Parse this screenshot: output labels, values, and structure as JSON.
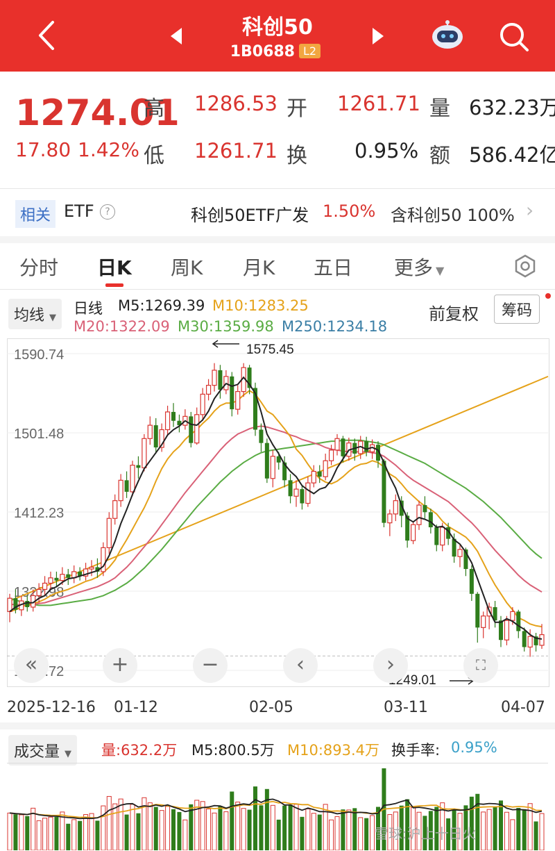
{
  "header": {
    "title": "科创50",
    "code": "1B0688",
    "level_badge": "L2",
    "background_color": "#e8302b"
  },
  "quote": {
    "price": "1274.01",
    "change": "17.80",
    "change_pct": "1.42%",
    "labels": {
      "high": "高",
      "open": "开",
      "volume": "量",
      "low": "低",
      "turnover": "换",
      "amount": "额"
    },
    "high": "1286.53",
    "open": "1261.71",
    "volume": "632.23万",
    "low": "1261.71",
    "turnover_rate": "0.95%",
    "amount": "586.42亿"
  },
  "etf_bar": {
    "related_label": "相关",
    "etf_label": "ETF",
    "help_glyph": "?",
    "fund_name": "科创50ETF广发",
    "fund_change": "1.50%",
    "contains_label": "含科创50",
    "contains_pct": "100%"
  },
  "tabs": [
    {
      "label": "分时",
      "active": false
    },
    {
      "label": "日K",
      "active": true
    },
    {
      "label": "周K",
      "active": false
    },
    {
      "label": "月K",
      "active": false
    },
    {
      "label": "五日",
      "active": false
    },
    {
      "label": "更多",
      "active": false
    }
  ],
  "ma_bar": {
    "selector": "均线",
    "period": "日线",
    "m5": "M5:1269.39",
    "m10": "M10:1283.25",
    "m20": "M20:1322.09",
    "m30": "M30:1359.98",
    "m250": "M250:1234.18",
    "adjust": "前复权",
    "chips_button": "筹码",
    "colors": {
      "m5": "#222222",
      "m10": "#e5a21a",
      "m20": "#d96177",
      "m30": "#5aac44",
      "m250": "#3a7ea5",
      "rise": "#d9342f",
      "fall": "#2f7d1c"
    }
  },
  "controls": [
    "«",
    "+",
    "−",
    "‹",
    "›"
  ],
  "chart_data": {
    "type": "candlestick",
    "y_ticks": [
      "1590.74",
      "1501.48",
      "1412.23",
      "1322.98",
      "1233.72"
    ],
    "x_ticks": [
      "2025-12-16",
      "01-12",
      "02-05",
      "03-11",
      "04-07"
    ],
    "annotations": [
      "1575.45",
      "1249.01"
    ],
    "ylim": [
      1233.72,
      1590.74
    ],
    "candles": [
      [
        1300,
        1315,
        1288,
        1320
      ],
      [
        1315,
        1302,
        1298,
        1325
      ],
      [
        1302,
        1312,
        1295,
        1318
      ],
      [
        1312,
        1305,
        1300,
        1318
      ],
      [
        1305,
        1318,
        1300,
        1325
      ],
      [
        1318,
        1325,
        1310,
        1332
      ],
      [
        1325,
        1332,
        1318,
        1340
      ],
      [
        1332,
        1338,
        1325,
        1345
      ],
      [
        1338,
        1335,
        1328,
        1345
      ],
      [
        1335,
        1342,
        1330,
        1350
      ],
      [
        1342,
        1338,
        1330,
        1348
      ],
      [
        1338,
        1345,
        1332,
        1352
      ],
      [
        1345,
        1340,
        1335,
        1350
      ],
      [
        1340,
        1348,
        1335,
        1355
      ],
      [
        1348,
        1350,
        1340,
        1358
      ],
      [
        1350,
        1345,
        1338,
        1360
      ],
      [
        1345,
        1372,
        1340,
        1378
      ],
      [
        1372,
        1405,
        1365,
        1412
      ],
      [
        1405,
        1425,
        1398,
        1432
      ],
      [
        1425,
        1448,
        1418,
        1455
      ],
      [
        1448,
        1435,
        1428,
        1458
      ],
      [
        1435,
        1465,
        1430,
        1470
      ],
      [
        1465,
        1462,
        1450,
        1475
      ],
      [
        1462,
        1495,
        1458,
        1500
      ],
      [
        1495,
        1510,
        1488,
        1520
      ],
      [
        1510,
        1485,
        1478,
        1518
      ],
      [
        1485,
        1505,
        1480,
        1512
      ],
      [
        1505,
        1525,
        1498,
        1532
      ],
      [
        1525,
        1515,
        1508,
        1535
      ],
      [
        1515,
        1510,
        1502,
        1522
      ],
      [
        1510,
        1520,
        1505,
        1528
      ],
      [
        1520,
        1490,
        1485,
        1525
      ],
      [
        1490,
        1522,
        1488,
        1530
      ],
      [
        1522,
        1545,
        1515,
        1552
      ],
      [
        1545,
        1555,
        1538,
        1562
      ],
      [
        1555,
        1572,
        1548,
        1580
      ],
      [
        1572,
        1550,
        1540,
        1578
      ],
      [
        1550,
        1565,
        1545,
        1572
      ],
      [
        1565,
        1528,
        1520,
        1570
      ],
      [
        1528,
        1548,
        1522,
        1555
      ],
      [
        1548,
        1575,
        1542,
        1580
      ],
      [
        1575,
        1552,
        1545,
        1578
      ],
      [
        1552,
        1505,
        1498,
        1558
      ],
      [
        1505,
        1490,
        1480,
        1512
      ],
      [
        1490,
        1450,
        1445,
        1495
      ],
      [
        1450,
        1475,
        1440,
        1482
      ],
      [
        1475,
        1468,
        1460,
        1480
      ],
      [
        1468,
        1448,
        1440,
        1475
      ],
      [
        1448,
        1430,
        1422,
        1455
      ],
      [
        1430,
        1438,
        1418,
        1448
      ],
      [
        1438,
        1422,
        1415,
        1442
      ],
      [
        1422,
        1445,
        1418,
        1452
      ],
      [
        1445,
        1458,
        1440,
        1465
      ],
      [
        1458,
        1452,
        1445,
        1465
      ],
      [
        1452,
        1470,
        1448,
        1478
      ],
      [
        1470,
        1482,
        1465,
        1488
      ],
      [
        1482,
        1495,
        1476,
        1500
      ],
      [
        1495,
        1475,
        1468,
        1498
      ],
      [
        1475,
        1490,
        1470,
        1496
      ],
      [
        1490,
        1478,
        1470,
        1495
      ],
      [
        1478,
        1492,
        1472,
        1498
      ],
      [
        1492,
        1480,
        1475,
        1497
      ],
      [
        1480,
        1488,
        1472,
        1494
      ],
      [
        1488,
        1470,
        1462,
        1492
      ],
      [
        1470,
        1400,
        1395,
        1472
      ],
      [
        1400,
        1410,
        1385,
        1415
      ],
      [
        1410,
        1425,
        1402,
        1432
      ],
      [
        1425,
        1408,
        1395,
        1430
      ],
      [
        1408,
        1380,
        1372,
        1412
      ],
      [
        1380,
        1398,
        1376,
        1402
      ],
      [
        1398,
        1420,
        1392,
        1425
      ],
      [
        1420,
        1412,
        1405,
        1430
      ],
      [
        1412,
        1395,
        1388,
        1416
      ],
      [
        1395,
        1375,
        1368,
        1398
      ],
      [
        1375,
        1395,
        1368,
        1400
      ],
      [
        1395,
        1382,
        1375,
        1400
      ],
      [
        1382,
        1362,
        1355,
        1388
      ],
      [
        1362,
        1370,
        1350,
        1375
      ],
      [
        1370,
        1348,
        1340,
        1372
      ],
      [
        1348,
        1320,
        1312,
        1352
      ],
      [
        1320,
        1282,
        1265,
        1322
      ],
      [
        1282,
        1295,
        1270,
        1300
      ],
      [
        1295,
        1305,
        1280,
        1310
      ],
      [
        1305,
        1290,
        1282,
        1312
      ],
      [
        1290,
        1268,
        1260,
        1295
      ],
      [
        1268,
        1290,
        1262,
        1295
      ],
      [
        1290,
        1300,
        1285,
        1305
      ],
      [
        1300,
        1278,
        1270,
        1302
      ],
      [
        1278,
        1260,
        1255,
        1282
      ],
      [
        1260,
        1272,
        1249,
        1280
      ],
      [
        1272,
        1262,
        1255,
        1276
      ],
      [
        1262,
        1274,
        1258,
        1286
      ]
    ],
    "ma5": [
      1300,
      1305,
      1308,
      1310,
      1310,
      1315,
      1318,
      1325,
      1328,
      1333,
      1337,
      1338,
      1340,
      1342,
      1344,
      1346,
      1351,
      1363,
      1379,
      1399,
      1415,
      1432,
      1447,
      1461,
      1470,
      1479,
      1488,
      1499,
      1505,
      1509,
      1515,
      1511,
      1510,
      1516,
      1526,
      1540,
      1549,
      1557,
      1554,
      1556,
      1564,
      1556,
      1546,
      1525,
      1500,
      1488,
      1478,
      1466,
      1458,
      1452,
      1442,
      1437,
      1433,
      1438,
      1440,
      1448,
      1462,
      1472,
      1482,
      1484,
      1486,
      1483,
      1485,
      1482,
      1468,
      1452,
      1439,
      1420,
      1405,
      1401,
      1406,
      1404,
      1401,
      1395,
      1396,
      1391,
      1381,
      1376,
      1367,
      1355,
      1337,
      1319,
      1301,
      1288,
      1288,
      1292,
      1289,
      1284,
      1280,
      1274,
      1270,
      1269
    ],
    "ma10": [
      1300,
      1302,
      1305,
      1308,
      1309,
      1311,
      1314,
      1318,
      1321,
      1323,
      1325,
      1328,
      1331,
      1334,
      1336,
      1339,
      1344,
      1350,
      1358,
      1370,
      1381,
      1393,
      1405,
      1417,
      1431,
      1447,
      1461,
      1472,
      1480,
      1486,
      1494,
      1500,
      1505,
      1512,
      1518,
      1526,
      1532,
      1535,
      1535,
      1538,
      1544,
      1549,
      1545,
      1536,
      1526,
      1522,
      1514,
      1506,
      1497,
      1483,
      1476,
      1466,
      1457,
      1450,
      1446,
      1444,
      1447,
      1452,
      1458,
      1463,
      1466,
      1467,
      1470,
      1468,
      1463,
      1455,
      1451,
      1444,
      1436,
      1430,
      1424,
      1419,
      1415,
      1410,
      1402,
      1396,
      1392,
      1388,
      1384,
      1377,
      1368,
      1355,
      1342,
      1330,
      1320,
      1310,
      1302,
      1293,
      1290,
      1286,
      1284,
      1283
    ],
    "ma20": [
      1308,
      1308,
      1307,
      1307,
      1308,
      1309,
      1310,
      1312,
      1314,
      1316,
      1318,
      1320,
      1322,
      1324,
      1326,
      1328,
      1331,
      1334,
      1338,
      1344,
      1350,
      1357,
      1365,
      1373,
      1381,
      1389,
      1398,
      1407,
      1416,
      1425,
      1434,
      1442,
      1450,
      1458,
      1466,
      1474,
      1482,
      1489,
      1495,
      1500,
      1503,
      1506,
      1508,
      1509,
      1508,
      1506,
      1504,
      1502,
      1499,
      1497,
      1494,
      1492,
      1490,
      1488,
      1485,
      1483,
      1482,
      1481,
      1480,
      1480,
      1480,
      1480,
      1479,
      1478,
      1475,
      1470,
      1465,
      1459,
      1453,
      1448,
      1444,
      1440,
      1436,
      1432,
      1428,
      1424,
      1418,
      1412,
      1406,
      1400,
      1393,
      1385,
      1377,
      1369,
      1362,
      1355,
      1348,
      1341,
      1335,
      1330,
      1326,
      1322
    ],
    "ma30": [
      1315,
      1313,
      1311,
      1309,
      1308,
      1307,
      1307,
      1307,
      1308,
      1309,
      1310,
      1311,
      1312,
      1313,
      1314,
      1316,
      1318,
      1321,
      1324,
      1328,
      1332,
      1337,
      1343,
      1349,
      1356,
      1363,
      1370,
      1378,
      1386,
      1394,
      1402,
      1410,
      1418,
      1425,
      1432,
      1439,
      1446,
      1452,
      1458,
      1463,
      1468,
      1472,
      1476,
      1479,
      1481,
      1482,
      1483,
      1484,
      1485,
      1486,
      1487,
      1488,
      1489,
      1490,
      1491,
      1492,
      1492,
      1493,
      1493,
      1493,
      1493,
      1492,
      1491,
      1490,
      1488,
      1485,
      1482,
      1479,
      1476,
      1473,
      1470,
      1467,
      1463,
      1459,
      1455,
      1451,
      1447,
      1443,
      1439,
      1434,
      1429,
      1424,
      1418,
      1412,
      1406,
      1399,
      1392,
      1385,
      1378,
      1371,
      1365,
      1360
    ],
    "ma250_start": 1312,
    "ma250_end": 1565,
    "last_close_ref": 1250
  },
  "volume": {
    "selector": "成交量",
    "vol": "量:632.2万",
    "m5": "M5:800.5万",
    "m10": "M10:893.4万",
    "turnover_label": "换手率:",
    "turnover": "0.95%"
  },
  "watermark": "雪球:沪上十日火"
}
